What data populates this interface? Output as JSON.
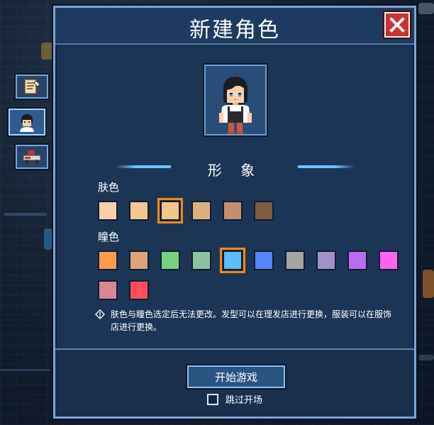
{
  "dialog": {
    "title": "新建角色",
    "section_title": "形 象",
    "skin_label": "肤色",
    "eye_label": "瞳色",
    "note": "肤色与瞳色选定后无法更改。发型可以在理发店进行更换，服装可以在服饰店进行更换。",
    "start_button": "开始游戏",
    "skip_label": "跳过开场",
    "skip_checked": false
  },
  "skin_colors": [
    "#f6d0ab",
    "#f3c698",
    "#eec88e",
    "#ddb07a",
    "#c38f6c",
    "#7e5b45"
  ],
  "skin_selected": 2,
  "eye_colors": [
    "#ff9a4e",
    "#d9a37e",
    "#73d27f",
    "#8cc2a2",
    "#5bbcff",
    "#5685ff",
    "#a4a4a4",
    "#a290c6",
    "#b86cf2",
    "#ff63f1",
    "#d68896",
    "#ff4f5f"
  ],
  "eye_selected": 4,
  "icons": {
    "close": "close-icon",
    "side_tabs": [
      "quest-scroll-icon",
      "character-avatar-icon",
      "vehicle-icon"
    ],
    "note": "warning-diamond-icon"
  }
}
